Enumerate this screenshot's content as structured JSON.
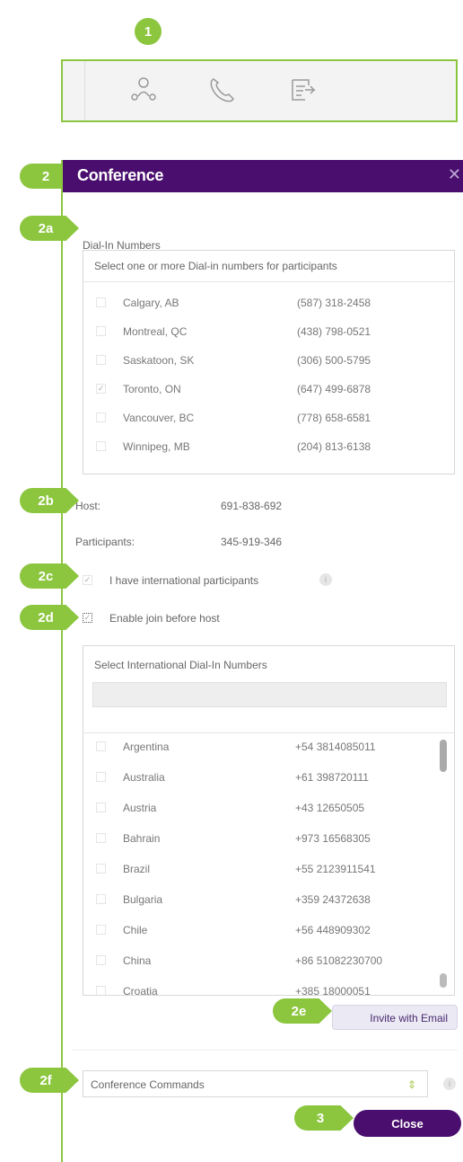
{
  "callouts": {
    "c1": "1",
    "c2": "2",
    "c2a": "2a",
    "c2b": "2b",
    "c2c": "2c",
    "c2d": "2d",
    "c2e": "2e",
    "c2f": "2f",
    "c3": "3"
  },
  "toolbar": {
    "icons": [
      "conference-icon",
      "phone-icon",
      "share-note-icon"
    ]
  },
  "dialog": {
    "title": "Conference",
    "dialin_label": "Dial-In Numbers",
    "dialin_header": "Select one or more Dial-in numbers for participants",
    "dialin_rows": [
      {
        "city": "Calgary, AB",
        "number": "(587) 318-2458",
        "checked": false
      },
      {
        "city": "Montreal, QC",
        "number": "(438) 798-0521",
        "checked": false
      },
      {
        "city": "Saskatoon, SK",
        "number": "(306) 500-5795",
        "checked": false
      },
      {
        "city": "Toronto, ON",
        "number": "(647) 499-6878",
        "checked": true
      },
      {
        "city": "Vancouver, BC",
        "number": "(778) 658-6581",
        "checked": false
      },
      {
        "city": "Winnipeg, MB",
        "number": "(204) 813-6138",
        "checked": false
      }
    ],
    "host_label": "Host:",
    "host_value": "691-838-692",
    "participants_label": "Participants:",
    "participants_value": "345-919-346",
    "intl_label": "I have international participants",
    "join_label": "Enable join before host",
    "intl_header": "Select International Dial-In Numbers",
    "intl_rows": [
      {
        "country": "Argentina",
        "number": "+54 3814085011"
      },
      {
        "country": "Australia",
        "number": "+61 398720111"
      },
      {
        "country": "Austria",
        "number": "+43 12650505"
      },
      {
        "country": "Bahrain",
        "number": "+973 16568305"
      },
      {
        "country": "Brazil",
        "number": "+55 2123911541"
      },
      {
        "country": "Bulgaria",
        "number": "+359 24372638"
      },
      {
        "country": "Chile",
        "number": "+56 448909302"
      },
      {
        "country": "China",
        "number": "+86 51082230700"
      },
      {
        "country": "Croatia",
        "number": "+385 18000051"
      }
    ],
    "invite_label": "Invite with Email",
    "commands_value": "Conference Commands",
    "close_label": "Close"
  },
  "colors": {
    "accent": "#8cc63f",
    "brand": "#4a0f6e"
  }
}
